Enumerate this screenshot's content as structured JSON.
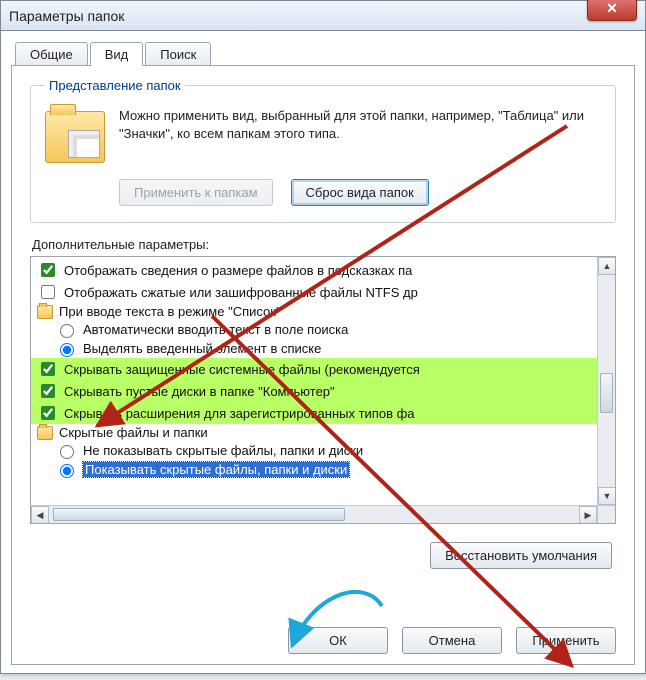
{
  "window": {
    "title": "Параметры папок"
  },
  "tabs": {
    "general": "Общие",
    "view": "Вид",
    "search": "Поиск"
  },
  "group": {
    "legend": "Представление папок",
    "desc": "Можно применить вид, выбранный для этой папки, например, \"Таблица\" или \"Значки\", ко всем папкам этого типа.",
    "apply_btn": "Применить к папкам",
    "reset_btn": "Сброс вида папок"
  },
  "advanced": {
    "label": "Дополнительные параметры:",
    "items": [
      {
        "kind": "check",
        "checked": true,
        "indent": 0,
        "hl": false,
        "text": "Отображать сведения о размере файлов в подсказках па"
      },
      {
        "kind": "check",
        "checked": false,
        "indent": 0,
        "hl": false,
        "text": "Отображать сжатые или зашифрованные файлы NTFS др"
      },
      {
        "kind": "folder",
        "indent": 0,
        "hl": false,
        "text": "При вводе текста в режиме \"Список\""
      },
      {
        "kind": "radio",
        "checked": false,
        "indent": 1,
        "hl": false,
        "group": "g1",
        "text": "Автоматически вводить текст в поле поиска"
      },
      {
        "kind": "radio",
        "checked": true,
        "indent": 1,
        "hl": false,
        "group": "g1",
        "text": "Выделять введенный элемент в списке"
      },
      {
        "kind": "check",
        "checked": true,
        "indent": 0,
        "hl": true,
        "text": "Скрывать защищенные системные файлы (рекомендуется"
      },
      {
        "kind": "check",
        "checked": true,
        "indent": 0,
        "hl": true,
        "text": "Скрывать пустые диски в папке \"Компьютер\""
      },
      {
        "kind": "check",
        "checked": true,
        "indent": 0,
        "hl": true,
        "text": "Скрывать расширения для зарегистрированных типов фа"
      },
      {
        "kind": "folder",
        "indent": 0,
        "hl": false,
        "text": "Скрытые файлы и папки"
      },
      {
        "kind": "radio",
        "checked": false,
        "indent": 1,
        "hl": false,
        "group": "g2",
        "text": "Не показывать скрытые файлы, папки и диски"
      },
      {
        "kind": "radio",
        "checked": true,
        "indent": 1,
        "hl": false,
        "group": "g2",
        "selected": true,
        "text": "Показывать скрытые файлы, папки и диски"
      }
    ]
  },
  "restore_btn": "Восстановить умолчания",
  "buttons": {
    "ok": "ОК",
    "cancel": "Отмена",
    "apply": "Применить"
  }
}
